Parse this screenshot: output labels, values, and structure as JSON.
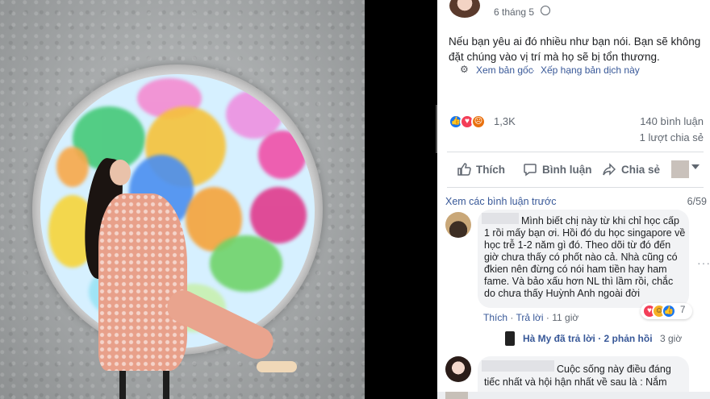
{
  "post": {
    "time": "6 tháng 5",
    "text": "Nếu bạn yêu ai đó nhiều như bạn nói. Bạn sẽ không đặt chúng vào vị trí mà họ sẽ bị tổn thương.",
    "see_original": "Xem bản gốc",
    "separator": "·",
    "rate_translation": "Xếp hạng bản dịch này"
  },
  "stats": {
    "reaction_count": "1,3K",
    "comments": "140 bình luận",
    "shares": "1 lượt chia sẻ"
  },
  "actions": {
    "like": "Thích",
    "comment": "Bình luận",
    "share": "Chia sẻ"
  },
  "comments_header": {
    "view_previous": "Xem các bình luận trước",
    "pager": "6/59"
  },
  "comments": [
    {
      "text": "Mình biết chị này từ khi chỉ học cấp 1 rồi mấy bạn ơi. Hồi đó du học singapore về học trễ 1-2 năm gì đó. Theo dõi từ đó đến giờ chưa thấy có phốt nào cả. Nhà cũng có đkien nên đừng có nói ham tiền hay ham fame. Và bảo xấu hơn NL thì lầm rồi, chắc do chưa thấy Huỳnh Anh ngoài đời",
      "like": "Thích",
      "reply": "Trả lời",
      "time": "11 giờ",
      "reaction_count": "7",
      "more": "···",
      "replies": {
        "text": "Hà My đã trả lời · 2 phản hồi",
        "time": "3 giờ"
      }
    },
    {
      "text": "Cuộc sống này điều đáng tiếc nhất và hội hận nhất về sau là : Nắm"
    }
  ],
  "colors": {
    "link": "#385898",
    "muted": "#606770",
    "bubble": "#f2f3f5",
    "like_blue": "#1877f2",
    "love_red": "#f33e58",
    "angry_orange": "#e9710f"
  },
  "icons": [
    "globe-icon",
    "gear-icon",
    "like-icon",
    "comment-icon",
    "share-icon",
    "chevron-down-icon",
    "more-icon"
  ]
}
